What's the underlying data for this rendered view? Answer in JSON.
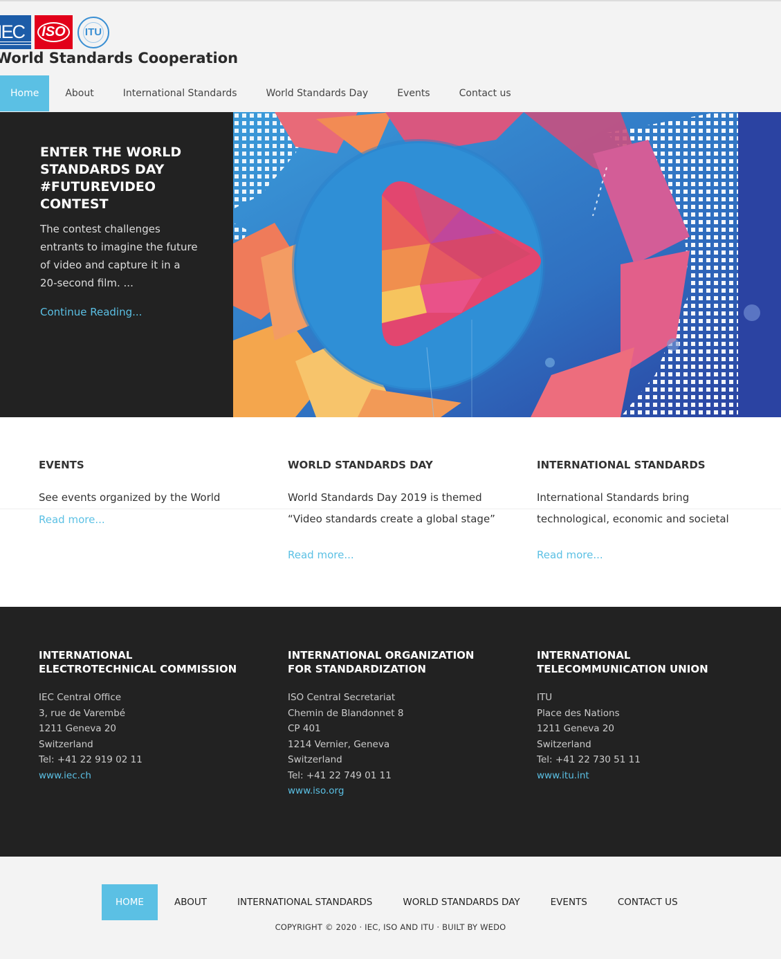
{
  "brand": {
    "logo_iec_text": "IEC",
    "logo_iso_text": "ISO",
    "logo_itu_text": "ITU",
    "site_title": "World Standards Cooperation"
  },
  "nav": {
    "items": [
      {
        "label": "Home",
        "active": true
      },
      {
        "label": "About"
      },
      {
        "label": "International Standards"
      },
      {
        "label": "World Standards Day"
      },
      {
        "label": "Events"
      },
      {
        "label": "Contact us"
      }
    ]
  },
  "hero": {
    "title": "Enter the World Standards Day #FutureVideo Contest",
    "description": "The contest challenges entrants to imagine the future of video and capture it in a 20-second film. ...",
    "link": "Continue Reading...",
    "image_icon": "play-button-illustration"
  },
  "features": [
    {
      "title": "Events",
      "text": "See events organized by the World Standards Cooperation",
      "link": "Read more..."
    },
    {
      "title": "World Standards Day",
      "text": "World Standards Day 2019 is themed “Video standards create a global stage” message from IEC, ISO and ...",
      "link": "Read more..."
    },
    {
      "title": "International Standards",
      "text": "International Standards bring technological, economic and societal technical and other specifications of ...",
      "link": "Read more..."
    }
  ],
  "footer": {
    "columns": [
      {
        "title": "International Electrotechnical Commission",
        "lines": [
          "IEC Central Office",
          "3, rue de Varembé",
          "1211 Geneva 20",
          "Switzerland",
          "Tel: +41 22 919 02 11"
        ],
        "link": "www.iec.ch"
      },
      {
        "title": "International Organization for Standardization",
        "lines": [
          "ISO Central Secretariat",
          "Chemin de Blandonnet 8",
          "CP 401",
          "1214 Vernier, Geneva",
          "Switzerland",
          "Tel: +41 22 749 01 11"
        ],
        "link": "www.iso.org"
      },
      {
        "title": "International Telecommunication Union",
        "lines": [
          "ITU",
          "Place des Nations",
          "1211 Geneva 20",
          "Switzerland",
          "Tel: +41 22 730 51 11"
        ],
        "link": "www.itu.int"
      }
    ]
  },
  "bottom_nav": {
    "items": [
      {
        "label": "Home",
        "active": true
      },
      {
        "label": "About"
      },
      {
        "label": "International Standards"
      },
      {
        "label": "World Standards Day"
      },
      {
        "label": "Events"
      },
      {
        "label": "Contact us"
      }
    ],
    "copyright": "Copyright © 2020 · IEC, ISO and ITU · Built by WeDo"
  },
  "colors": {
    "accent": "#5bc0e4",
    "dark": "#222222",
    "iec_blue": "#1c5ca8",
    "iso_red": "#e2001a",
    "itu_blue": "#3a8fd3"
  }
}
